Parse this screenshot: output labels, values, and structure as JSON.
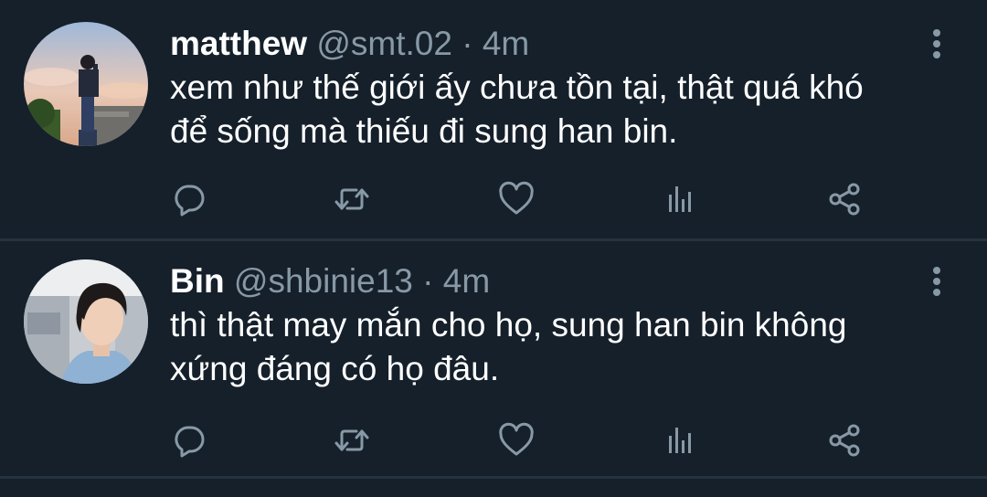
{
  "tweets": [
    {
      "name": "matthew",
      "handle": "@smt.02",
      "separator": "·",
      "time": "4m",
      "text_line1": "xem như thế giới ấy chưa tồn tại, thật quá khó",
      "text_line2": "để sống mà thiếu đi sung han bin.",
      "avatar_icon": "avatar-person-standing-sunset",
      "actions": [
        "reply-icon",
        "retweet-icon",
        "like-icon",
        "views-icon",
        "share-icon"
      ]
    },
    {
      "name": "Bin",
      "handle": "@shbinie13",
      "separator": "·",
      "time": "4m",
      "text_line1": "thì thật may mắn cho họ, sung han bin không",
      "text_line2": "xứng đáng có họ đâu.",
      "avatar_icon": "avatar-person-portrait",
      "actions": [
        "reply-icon",
        "retweet-icon",
        "like-icon",
        "views-icon",
        "share-icon"
      ]
    }
  ],
  "colors": {
    "background": "#15202b",
    "divider": "#253341",
    "secondary_text": "#8899a6",
    "primary_text": "#ffffff"
  }
}
